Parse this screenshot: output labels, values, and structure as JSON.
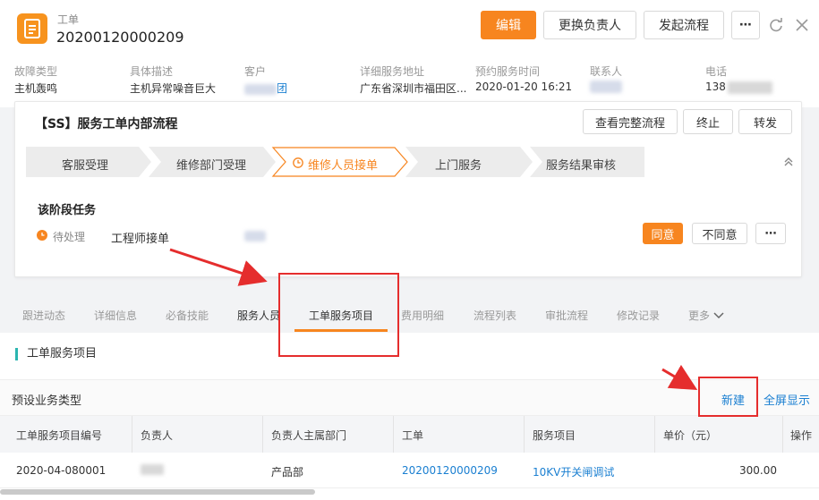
{
  "header": {
    "label": "工单",
    "number": "20200120000209",
    "buttons": {
      "edit": "编辑",
      "change_owner": "更换负责人",
      "start_process": "发起流程",
      "more": "⋯"
    },
    "fields": [
      {
        "label": "故障类型",
        "value": "主机轰鸣"
      },
      {
        "label": "具体描述",
        "value": "主机异常噪音巨大"
      },
      {
        "label": "客户",
        "value": "团"
      },
      {
        "label": "详细服务地址",
        "value": "广东省深圳市福田区..."
      },
      {
        "label": "预约服务时间",
        "value": "2020-01-20 16:21"
      },
      {
        "label": "联系人",
        "value": ""
      },
      {
        "label": "电话",
        "value": "138"
      }
    ]
  },
  "process": {
    "title": "【SS】服务工单内部流程",
    "buttons": {
      "view_full": "查看完整流程",
      "terminate": "终止",
      "forward": "转发"
    },
    "stages": [
      "客服受理",
      "维修部门受理",
      "维修人员接单",
      "上门服务",
      "服务结果审核"
    ],
    "active_stage_index": 2,
    "task_heading": "该阶段任务",
    "task_status": "待处理",
    "task_name": "工程师接单",
    "actions": {
      "agree": "同意",
      "disagree": "不同意",
      "more": "⋯"
    }
  },
  "tabs": [
    "跟进动态",
    "详细信息",
    "必备技能",
    "服务人员",
    "工单服务项目",
    "费用明细",
    "流程列表",
    "审批流程",
    "修改记录",
    "更多"
  ],
  "active_tab": "工单服务项目",
  "section": {
    "title": "工单服务项目",
    "subbar_title": "预设业务类型",
    "new_label": "新建",
    "fullscreen_label": "全屏显示"
  },
  "table": {
    "columns": [
      "工单服务项目编号",
      "负责人",
      "负责人主属部门",
      "工单",
      "服务项目",
      "单价（元）",
      "操作"
    ],
    "rows": [
      {
        "code": "2020-04-080001",
        "owner": "",
        "dept": "产品部",
        "order": "20200120000209",
        "item": "10KV开关闸调试",
        "price": "300.00"
      }
    ]
  },
  "colors": {
    "accent": "#f7851f",
    "link": "#1a7fd1",
    "highlight": "#e52d2d",
    "section_bar": "#2bb5b0"
  }
}
